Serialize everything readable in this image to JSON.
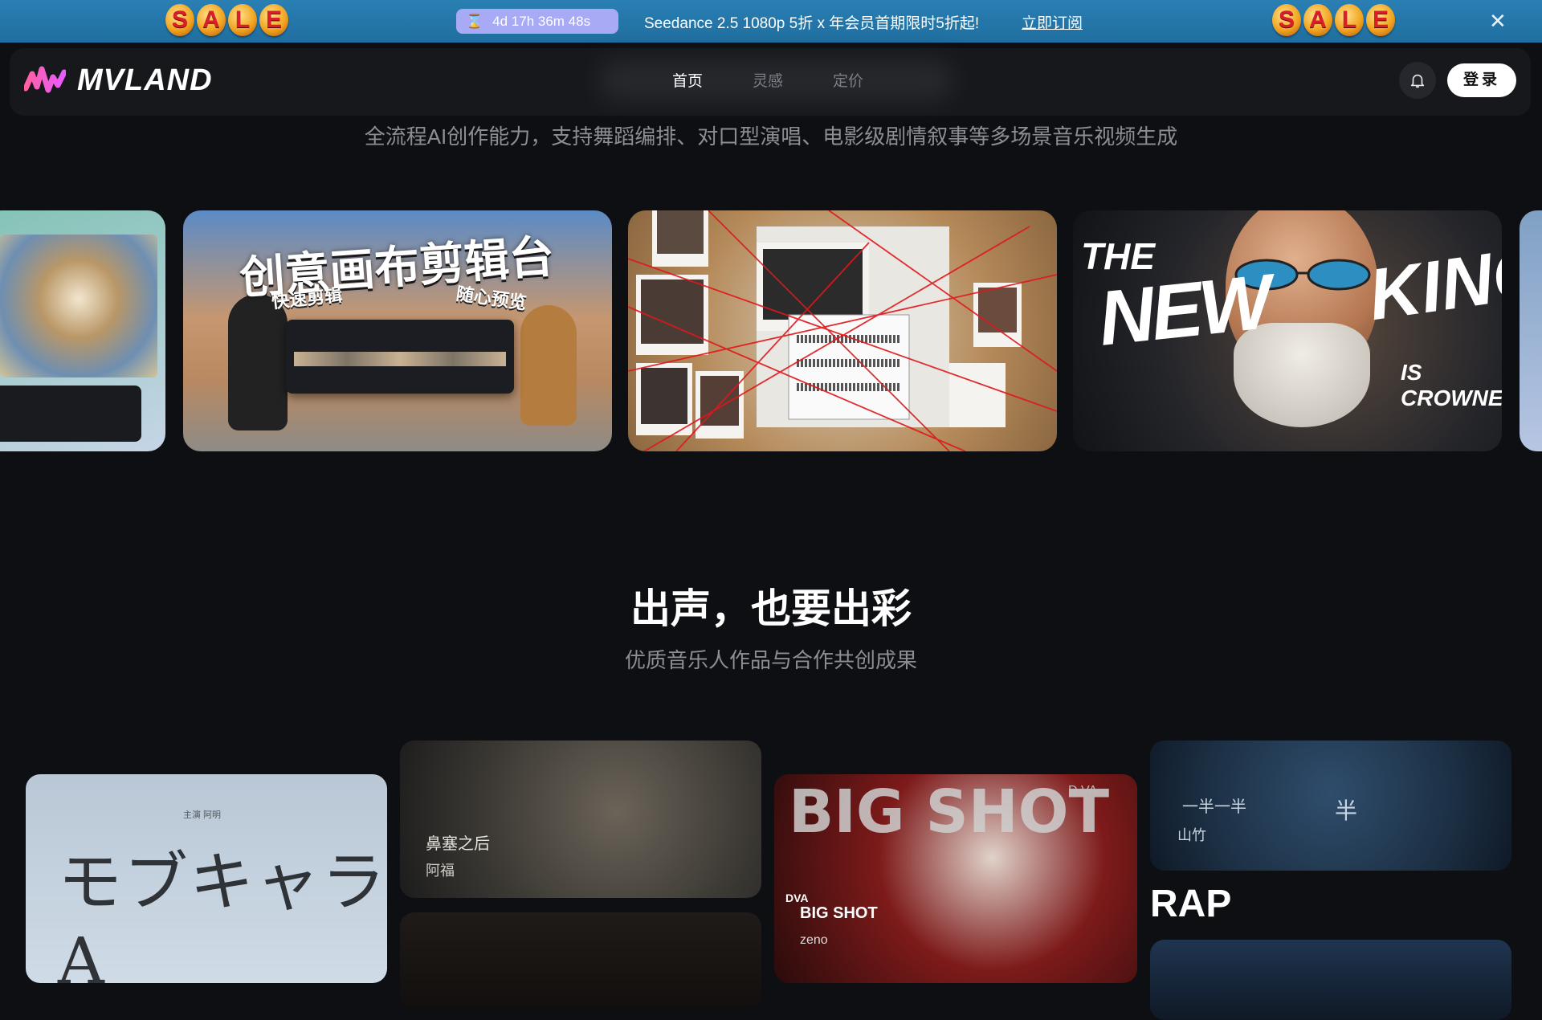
{
  "banner": {
    "sale_letters": [
      "S",
      "A",
      "L",
      "E"
    ],
    "countdown": "4d 17h 36m 48s",
    "promo_text": "Seedance 2.5 1080p 5折 x 年会员首期限时5折起!",
    "link_label": "立即订阅",
    "close_icon": "close-icon",
    "colors": {
      "background": "#2a7fb3",
      "timer_bg": "#a8aaf6"
    }
  },
  "nav": {
    "brand": "MVLAND",
    "links": [
      {
        "label": "首页",
        "active": true
      },
      {
        "label": "灵感",
        "active": false
      },
      {
        "label": "定价",
        "active": false
      }
    ],
    "bell_icon": "bell-icon",
    "login_label": "登录"
  },
  "hero": {
    "subtitle": "全流程AI创作能力，支持舞蹈编排、对口型演唱、电影级剧情叙事等多场景音乐视频生成"
  },
  "carousel": {
    "card1": {
      "title": "创意画布剪辑台",
      "tag_left": "快速剪辑",
      "tag_right": "随心预览"
    },
    "card3": {
      "the": "THE",
      "new": "NEW",
      "king": "KING",
      "crowned": "IS CROWNED"
    }
  },
  "section": {
    "title": "出声，也要出彩",
    "subtitle": "优质音乐人作品与合作共创成果"
  },
  "works": {
    "w1": {
      "title": "モブキャラA",
      "credit": "主演 阿明"
    },
    "w2": {
      "title": "鼻塞之后",
      "artist": "阿福"
    },
    "w3": {
      "big_text": "BIG SHOT",
      "label": "DVA",
      "subtitle": "BIG SHOT",
      "artist": "zeno",
      "corner": "D.VA"
    },
    "w4": {
      "left_text": "一半一半",
      "right_text": "半",
      "artist": "山竹"
    },
    "genre_label": "RAP"
  }
}
